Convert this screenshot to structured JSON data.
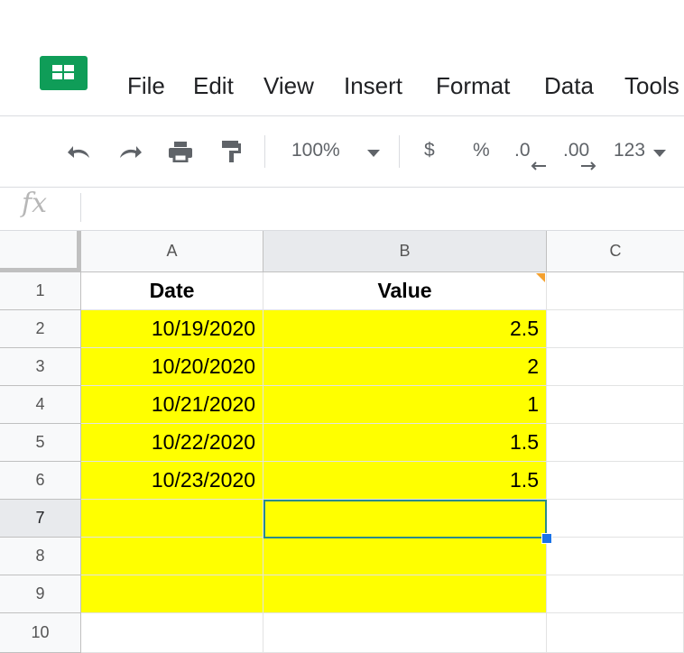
{
  "app": {
    "logo_icon": "sheets-logo-icon"
  },
  "menu": {
    "items": [
      "File",
      "Edit",
      "View",
      "Insert",
      "Format",
      "Data",
      "Tools"
    ]
  },
  "toolbar": {
    "undo_icon": "undo-icon",
    "redo_icon": "redo-icon",
    "print_icon": "print-icon",
    "paint_format_icon": "paint-format-icon",
    "zoom": "100%",
    "currency": "$",
    "percent": "%",
    "decrease_decimal": ".0",
    "increase_decimal": ".00",
    "more_formats": "123"
  },
  "formula_bar": {
    "label": "fx",
    "value": ""
  },
  "sheet": {
    "columns": [
      "A",
      "B",
      "C"
    ],
    "rows": [
      "1",
      "2",
      "3",
      "4",
      "5",
      "6",
      "7",
      "8",
      "9",
      "10"
    ],
    "selected_cell": "B7",
    "highlight_color": "#ffff00",
    "cells": {
      "A1": "Date",
      "B1": "Value",
      "A2": "10/19/2020",
      "B2": "2.5",
      "A3": "10/20/2020",
      "B3": "2",
      "A4": "10/21/2020",
      "B4": "1",
      "A5": "10/22/2020",
      "B5": "1.5",
      "A6": "10/23/2020",
      "B6": "1.5"
    }
  }
}
